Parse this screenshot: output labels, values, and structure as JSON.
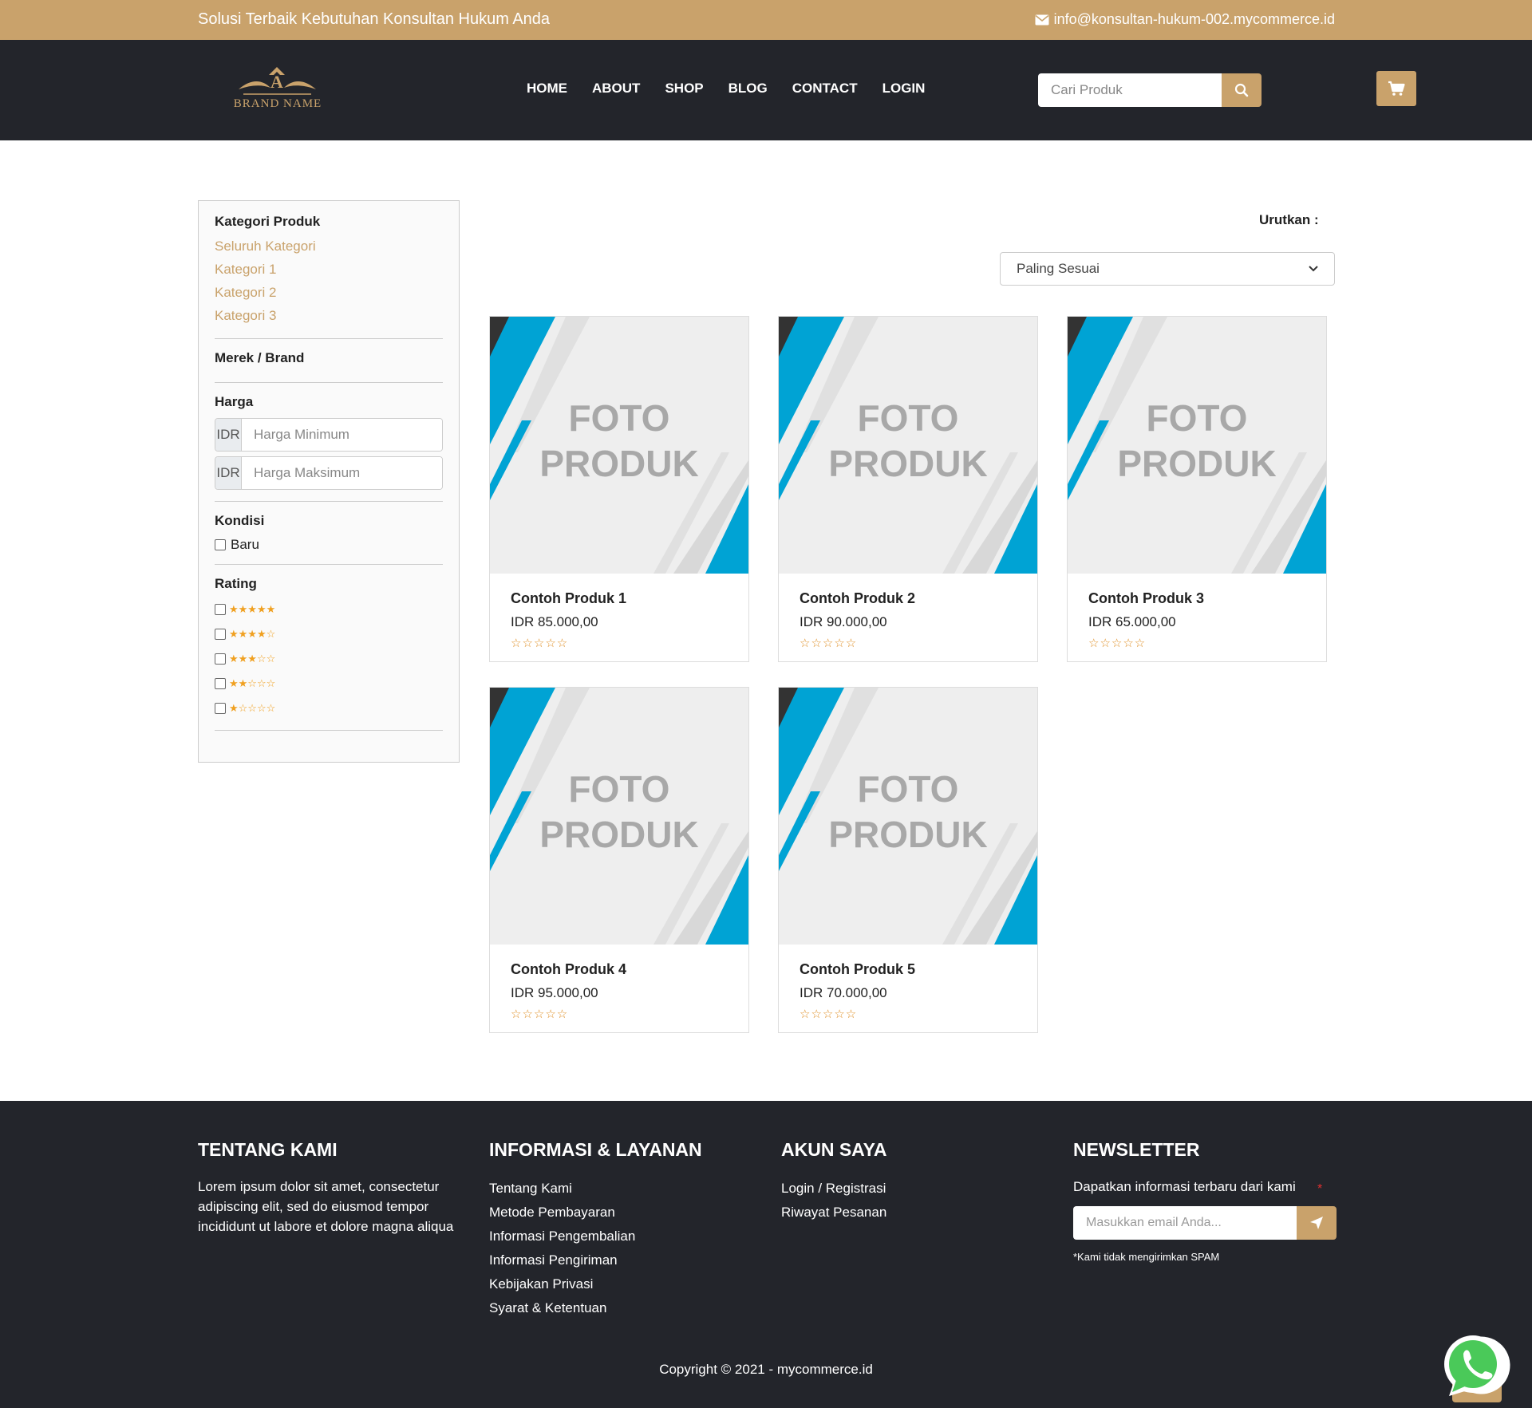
{
  "topbar": {
    "tagline": "Solusi Terbaik Kebutuhan Konsultan Hukum Anda",
    "email": "info@konsultan-hukum-002.mycommerce.id"
  },
  "header": {
    "logo_text": "BRAND NAME",
    "nav": [
      "HOME",
      "ABOUT",
      "SHOP",
      "BLOG",
      "CONTACT",
      "LOGIN"
    ],
    "search_placeholder": "Cari Produk"
  },
  "sidebar": {
    "category_title": "Kategori Produk",
    "categories": [
      "Seluruh Kategori",
      "Kategori 1",
      "Kategori 2",
      "Kategori 3"
    ],
    "brand_title": "Merek / Brand",
    "price_title": "Harga",
    "currency": "IDR",
    "min_placeholder": "Harga Minimum",
    "max_placeholder": "Harga Maksimum",
    "condition_title": "Kondisi",
    "condition_new": "Baru",
    "rating_title": "Rating",
    "ratings": [
      5,
      4,
      3,
      2,
      1
    ]
  },
  "sort": {
    "label": "Urutkan :",
    "selected": "Paling Sesuai"
  },
  "products": [
    {
      "image_text_1": "FOTO",
      "image_text_2": "PRODUK",
      "name": "Contoh Produk 1",
      "price": "IDR 85.000,00",
      "rating": 0
    },
    {
      "image_text_1": "FOTO",
      "image_text_2": "PRODUK",
      "name": "Contoh Produk 2",
      "price": "IDR 90.000,00",
      "rating": 0
    },
    {
      "image_text_1": "FOTO",
      "image_text_2": "PRODUK",
      "name": "Contoh Produk 3",
      "price": "IDR 65.000,00",
      "rating": 0
    },
    {
      "image_text_1": "FOTO",
      "image_text_2": "PRODUK",
      "name": "Contoh Produk 4",
      "price": "IDR 95.000,00",
      "rating": 0
    },
    {
      "image_text_1": "FOTO",
      "image_text_2": "PRODUK",
      "name": "Contoh Produk 5",
      "price": "IDR 70.000,00",
      "rating": 0
    }
  ],
  "footer": {
    "about_title": "TENTANG KAMI",
    "about_text": "Lorem ipsum dolor sit amet, consectetur adipiscing elit, sed do eiusmod tempor incididunt ut labore et dolore magna aliqua",
    "info_title": "INFORMASI & LAYANAN",
    "info_links": [
      "Tentang Kami",
      "Metode Pembayaran",
      "Informasi Pengembalian",
      "Informasi Pengiriman",
      "Kebijakan Privasi",
      "Syarat & Ketentuan"
    ],
    "account_title": "AKUN SAYA",
    "account_links": [
      "Login / Registrasi",
      "Riwayat Pesanan"
    ],
    "newsletter_title": "NEWSLETTER",
    "newsletter_text": "Dapatkan informasi terbaru dari kami",
    "newsletter_placeholder": "Masukkan email Anda...",
    "newsletter_required": "*",
    "spam_note": "*Kami tidak mengirimkan SPAM",
    "copyright": "Copyright © 2021 - mycommerce.id"
  },
  "colors": {
    "accent": "#c9a26b",
    "dark": "#23252b",
    "product_blue": "#00a3d4",
    "star": "#f0a020"
  }
}
